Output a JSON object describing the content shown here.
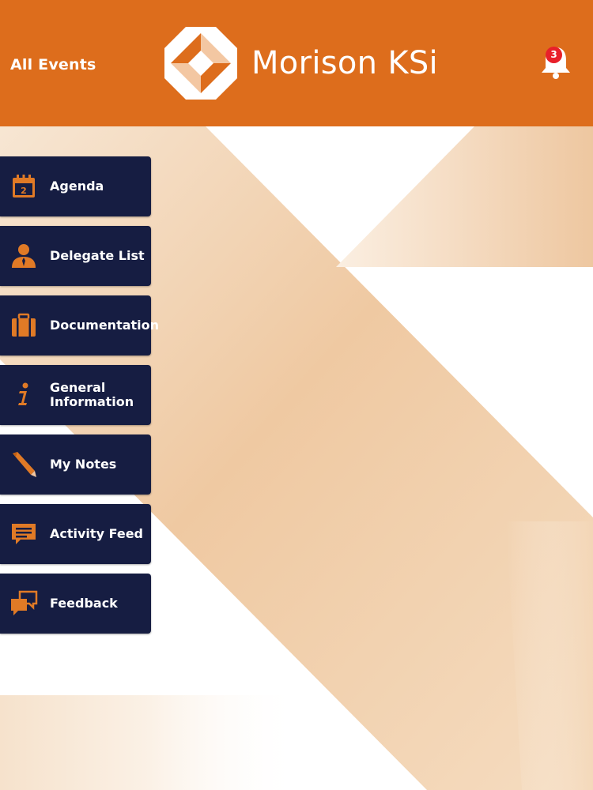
{
  "header": {
    "back_label": "All Events",
    "brand_name": "Morison KSi",
    "notification_count": "3"
  },
  "menu": {
    "items": [
      {
        "label": "Agenda",
        "icon": "calendar-icon",
        "calendar_day": "2"
      },
      {
        "label": "Delegate List",
        "icon": "person-icon"
      },
      {
        "label": "Documentation",
        "icon": "briefcase-icon"
      },
      {
        "label": "General\nInformation",
        "icon": "info-icon"
      },
      {
        "label": "My Notes",
        "icon": "pencil-icon"
      },
      {
        "label": "Activity Feed",
        "icon": "comment-icon"
      },
      {
        "label": "Feedback",
        "icon": "chat-bubbles-icon"
      }
    ]
  },
  "colors": {
    "header_orange": "#dd6d1c",
    "menu_navy": "#161d42",
    "icon_orange": "#e07a26",
    "badge_red": "#e8202a"
  }
}
